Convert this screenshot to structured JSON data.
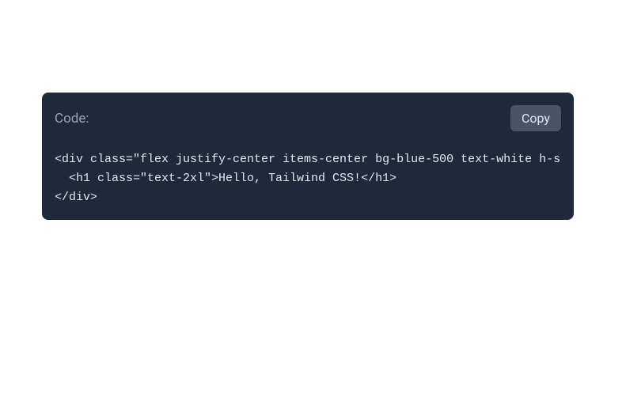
{
  "codeBlock": {
    "label": "Code:",
    "copyButton": "Copy",
    "content": "<div class=\"flex justify-center items-center bg-blue-500 text-white h-screen\">\n  <h1 class=\"text-2xl\">Hello, Tailwind CSS!</h1>\n</div>"
  }
}
